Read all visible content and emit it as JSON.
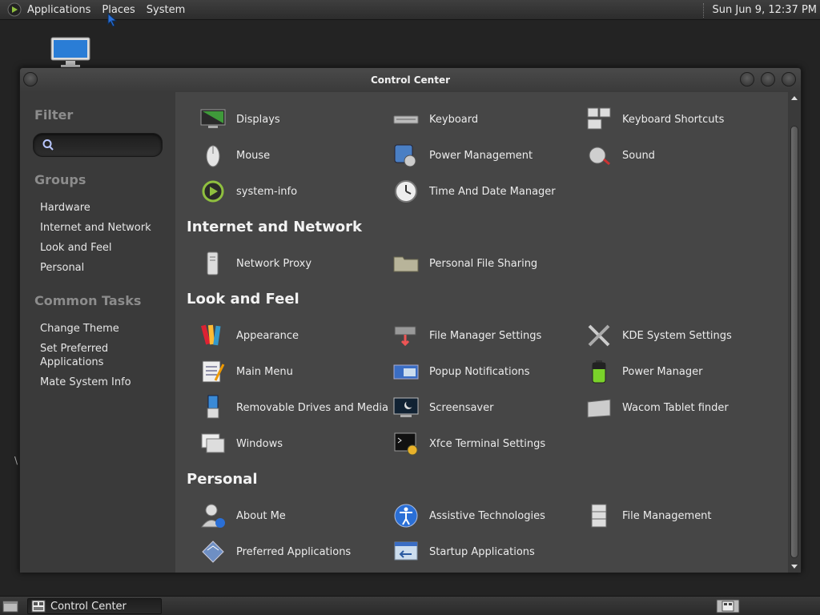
{
  "top_panel": {
    "menus": [
      "Applications",
      "Places",
      "System"
    ],
    "clock": "Sun Jun  9, 12:37 PM"
  },
  "window": {
    "title": "Control Center"
  },
  "sidebar": {
    "filter_heading": "Filter",
    "filter_value": "",
    "groups_heading": "Groups",
    "groups": [
      "Hardware",
      "Internet and Network",
      "Look and Feel",
      "Personal"
    ],
    "tasks_heading": "Common Tasks",
    "tasks": [
      "Change Theme",
      "Set Preferred Applications",
      "Mate System Info"
    ]
  },
  "sections": {
    "hardware": {
      "items": [
        {
          "label": "Displays",
          "icon": "display-icon"
        },
        {
          "label": "Keyboard",
          "icon": "keyboard-icon"
        },
        {
          "label": "Keyboard Shortcuts",
          "icon": "keyboard-shortcuts-icon"
        },
        {
          "label": "Mouse",
          "icon": "mouse-icon"
        },
        {
          "label": "Power Management",
          "icon": "power-management-icon"
        },
        {
          "label": "Sound",
          "icon": "sound-icon"
        },
        {
          "label": "system-info",
          "icon": "system-info-icon"
        },
        {
          "label": "Time And Date Manager",
          "icon": "clock-icon"
        }
      ]
    },
    "internet": {
      "title": "Internet and Network",
      "items": [
        {
          "label": "Network Proxy",
          "icon": "network-proxy-icon"
        },
        {
          "label": "Personal File Sharing",
          "icon": "file-sharing-icon"
        }
      ]
    },
    "look": {
      "title": "Look and Feel",
      "items": [
        {
          "label": "Appearance",
          "icon": "appearance-icon"
        },
        {
          "label": "File Manager Settings",
          "icon": "file-manager-icon"
        },
        {
          "label": "KDE System Settings",
          "icon": "tools-icon"
        },
        {
          "label": "Main Menu",
          "icon": "main-menu-icon"
        },
        {
          "label": "Popup Notifications",
          "icon": "notification-icon"
        },
        {
          "label": "Power Manager",
          "icon": "battery-icon"
        },
        {
          "label": "Removable Drives and Media",
          "icon": "usb-icon"
        },
        {
          "label": "Screensaver",
          "icon": "screensaver-icon"
        },
        {
          "label": "Wacom Tablet finder",
          "icon": "tablet-icon"
        },
        {
          "label": "Windows",
          "icon": "windows-icon"
        },
        {
          "label": "Xfce Terminal Settings",
          "icon": "terminal-icon"
        }
      ]
    },
    "personal": {
      "title": "Personal",
      "items": [
        {
          "label": "About Me",
          "icon": "user-icon"
        },
        {
          "label": "Assistive Technologies",
          "icon": "accessibility-icon"
        },
        {
          "label": "File Management",
          "icon": "file-cabinet-icon"
        },
        {
          "label": "Preferred Applications",
          "icon": "preferred-apps-icon"
        },
        {
          "label": "Startup Applications",
          "icon": "startup-icon"
        }
      ]
    }
  },
  "bottom_panel": {
    "task_label": "Control Center"
  },
  "colors": {
    "panel": "#2c2c2c",
    "window_bg": "#3a3a3a",
    "content_bg": "#464646",
    "heading_muted": "#8c8c8c"
  }
}
